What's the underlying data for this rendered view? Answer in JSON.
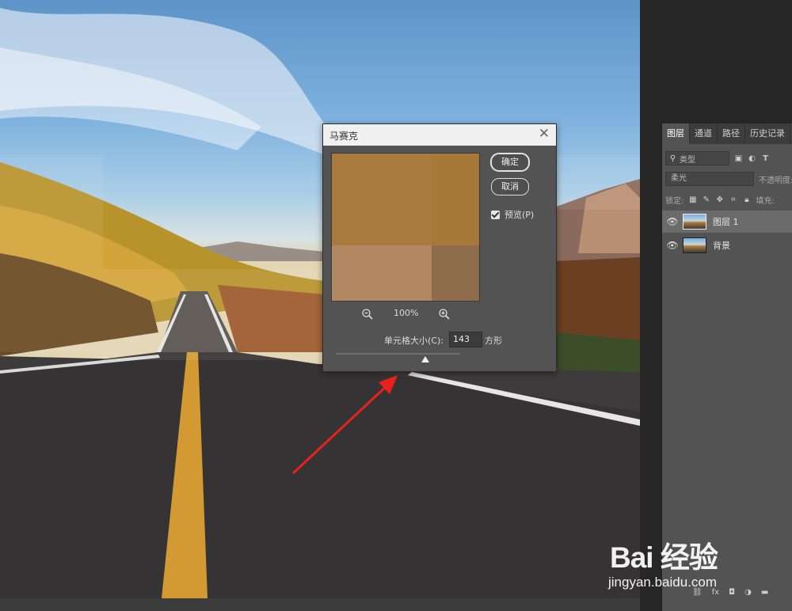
{
  "dialog": {
    "title": "马赛克",
    "ok_label": "确定",
    "cancel_label": "取消",
    "preview_label": "预览(P)",
    "preview_checked": true,
    "zoom_level": "100%",
    "cell_size_label": "单元格大小(C):",
    "cell_size_value": "143",
    "cell_size_unit": "方形",
    "preview_colors": [
      "#a97a3e",
      "#a77938",
      "#b18861",
      "#8f6d4c"
    ]
  },
  "layers_panel": {
    "tabs": [
      "图层",
      "通道",
      "路径",
      "历史记录"
    ],
    "active_tab": "图层",
    "filter_placeholder": "类型",
    "blend_mode": "柔光",
    "opacity_label": "不透明度:",
    "lock_label": "锁定:",
    "fill_label": "填充:",
    "layers": [
      {
        "name": "图层 1",
        "selected": true,
        "visible": true
      },
      {
        "name": "背景",
        "selected": false,
        "visible": true
      }
    ]
  },
  "watermark": {
    "logo": "Bai 经验",
    "url": "jingyan.baidu.com"
  },
  "colors": {
    "panel_bg": "#535353",
    "workspace_bg": "#262626",
    "arrow": "#e8221b"
  }
}
